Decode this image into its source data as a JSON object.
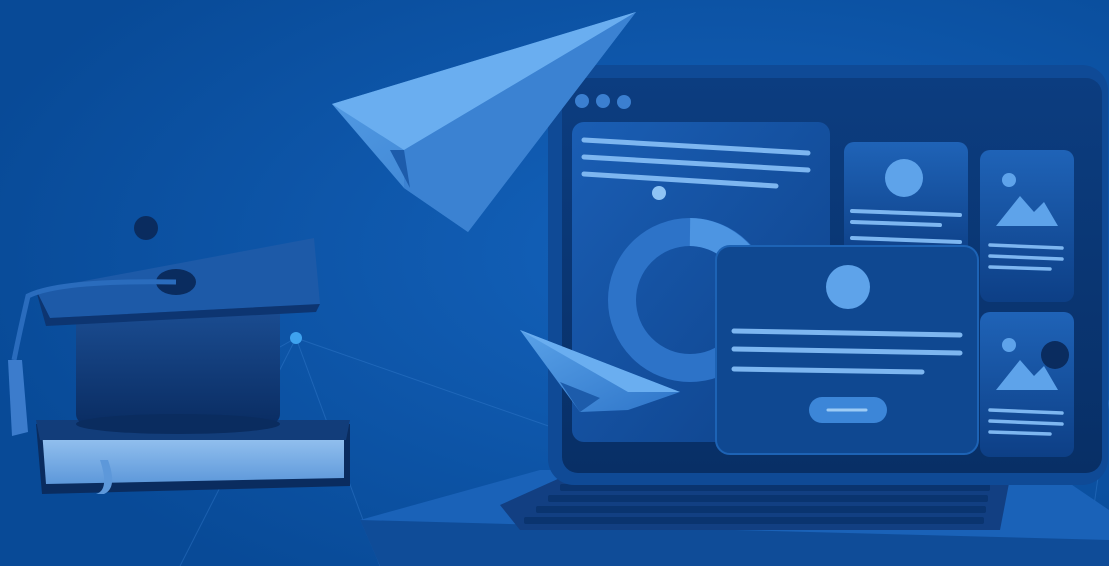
{
  "scene": {
    "kind": "illustration",
    "elements": [
      "graduation-cap",
      "book",
      "paper-plane-large",
      "paper-plane-small",
      "laptop",
      "donut-chart",
      "profile-card",
      "image-placeholder"
    ]
  },
  "colors": {
    "background": "#0a4f9c",
    "accent_light": "#5ea3ea",
    "accent_mid": "#2d73c8",
    "dark": "#08326b",
    "darker": "#062554"
  },
  "window": {
    "dots": 3
  }
}
